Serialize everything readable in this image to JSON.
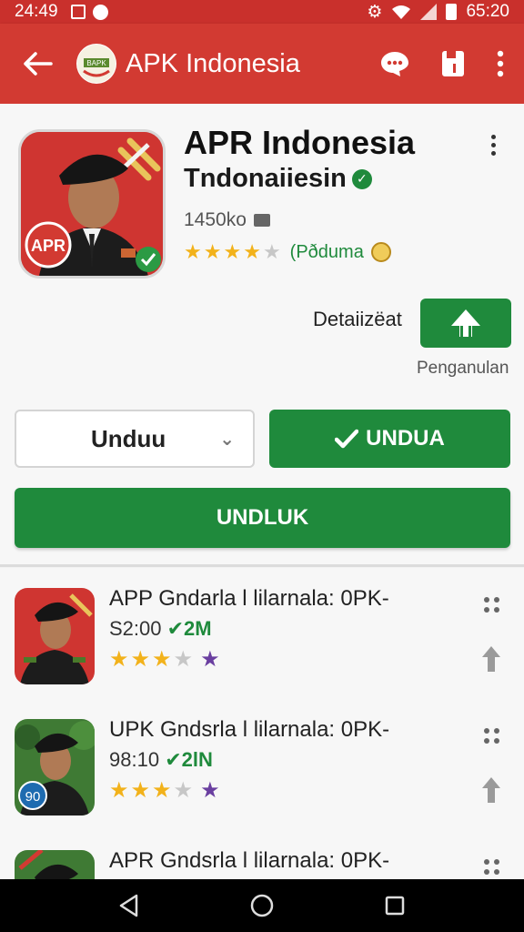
{
  "status_bar": {
    "time": "24:49",
    "clock_right": "65:20"
  },
  "app_bar": {
    "title": "APK Indonesia",
    "logo_text": "BAPK"
  },
  "app": {
    "name": "APR Indonesia",
    "developer": "Tndonaiiesin",
    "size": "1450ko",
    "rating_label": "(Pðduma",
    "rating_stars": 4.5,
    "icon_badge": "APR",
    "details_label": "Detaiizëat",
    "share_caption": "Penganulan"
  },
  "actions": {
    "dropdown_label": "Unduu",
    "install_label": "UNDUA",
    "download_label": "UNDLUK"
  },
  "list": [
    {
      "title": "APP Gndarla l lilarnala: 0PK-",
      "price": "S2:00",
      "downloads": "✔2M",
      "stars": 3.5,
      "badge": ""
    },
    {
      "title": "UPK Gndsrla l lilarnala: 0PK-",
      "price": "98:10",
      "downloads": "✔2lN",
      "stars": 3.5,
      "badge": "90"
    },
    {
      "title": "APR Gndsrla l lilarnala: 0PK-",
      "price": "",
      "downloads": "",
      "stars": 0,
      "badge": ""
    }
  ],
  "colors": {
    "primary_red": "#d23a32",
    "green": "#1f8a3c",
    "star": "#f2b21b",
    "purple_star": "#6a3fa0"
  }
}
